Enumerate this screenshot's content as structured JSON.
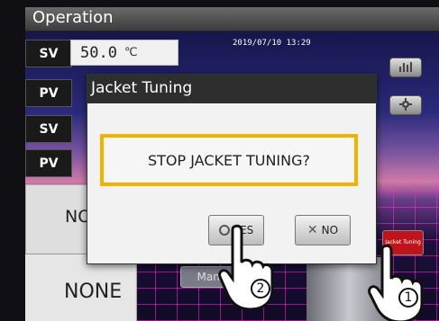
{
  "header": {
    "title": "Operation"
  },
  "tabs": [
    {
      "label": "SV"
    },
    {
      "label": "PV"
    },
    {
      "label": "SV"
    },
    {
      "label": "PV"
    }
  ],
  "setpoint": {
    "value": "50.0",
    "unit": "℃"
  },
  "datetime": "2019/07/10 13:29",
  "left_panel": {
    "top_label": "NO",
    "bottom_label": "NONE"
  },
  "manual_label": "Manu",
  "jacket_button": {
    "label": "Jacket Tuning"
  },
  "dialog": {
    "title": "Jacket Tuning",
    "message": "STOP JACKET TUNING?",
    "yes_label": "YES",
    "no_label": "NO"
  },
  "steps": {
    "step1": "1",
    "step2": "2"
  },
  "colors": {
    "highlight": "#f0b400",
    "dialog_header": "#2e2e2e",
    "jacket_button": "#c0141c"
  }
}
